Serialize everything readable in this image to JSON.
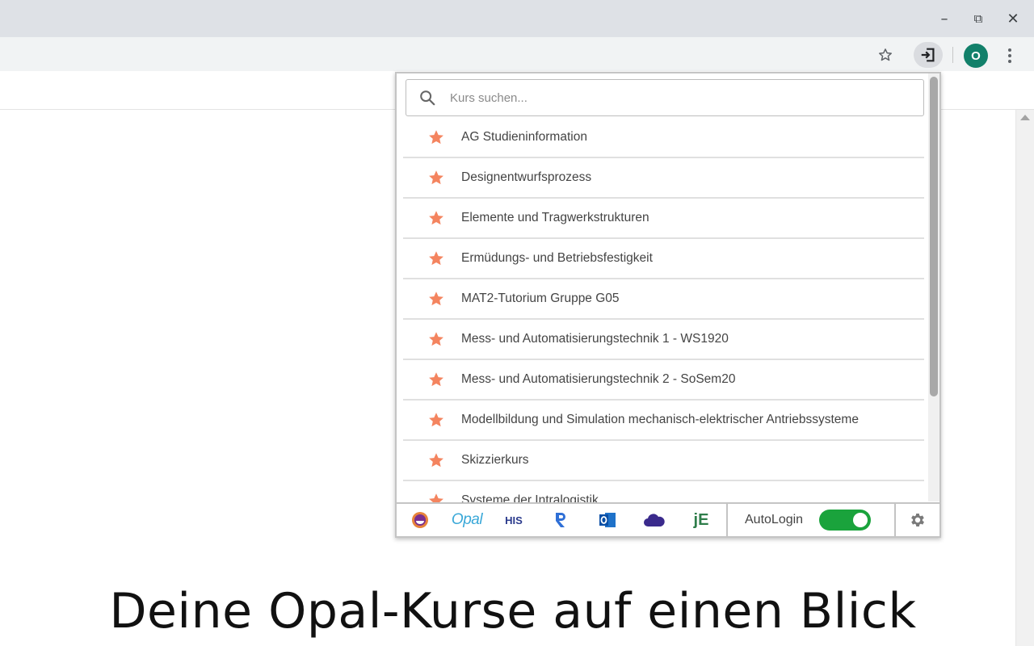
{
  "window": {
    "minimize_glyph": "–",
    "restore_glyph": "⧉",
    "close_glyph": "✕"
  },
  "toolbar": {
    "profile_initial": "O",
    "icons": [
      "star-bookmark-icon",
      "extension-login-icon",
      "profile-avatar",
      "more-menu-icon"
    ]
  },
  "popup": {
    "search": {
      "placeholder": "Kurs suchen...",
      "value": ""
    },
    "courses": [
      "AG Studieninformation",
      "Designentwurfsprozess",
      "Elemente und Tragwerkstrukturen",
      "Ermüdungs- und Betriebsfestigkeit",
      "MAT2-Tutorium Gruppe G05",
      "Mess- und Automatisierungstechnik 1 - WS1920",
      "Mess- und Automatisierungstechnik 2 - SoSem20",
      "Modellbildung und Simulation mechanisch-elektrischer Antriebssysteme",
      "Skizzierkurs",
      "Systeme der Intralogistik"
    ],
    "footer": {
      "links": [
        "mensa-icon",
        "opal-logo",
        "his-logo",
        "r-icon",
        "outlook-icon",
        "cloud-icon",
        "je-logo"
      ],
      "opal_text": "Opal",
      "his_text": "HIS",
      "je_text": "jE",
      "autologin_label": "AutoLogin",
      "autologin_enabled": true
    }
  },
  "caption": "Deine Opal-Kurse auf einen Blick",
  "colors": {
    "star": "#f4845f",
    "toggle_on": "#1aa33c",
    "avatar": "#12806a",
    "titlebar": "#dee1e6"
  }
}
